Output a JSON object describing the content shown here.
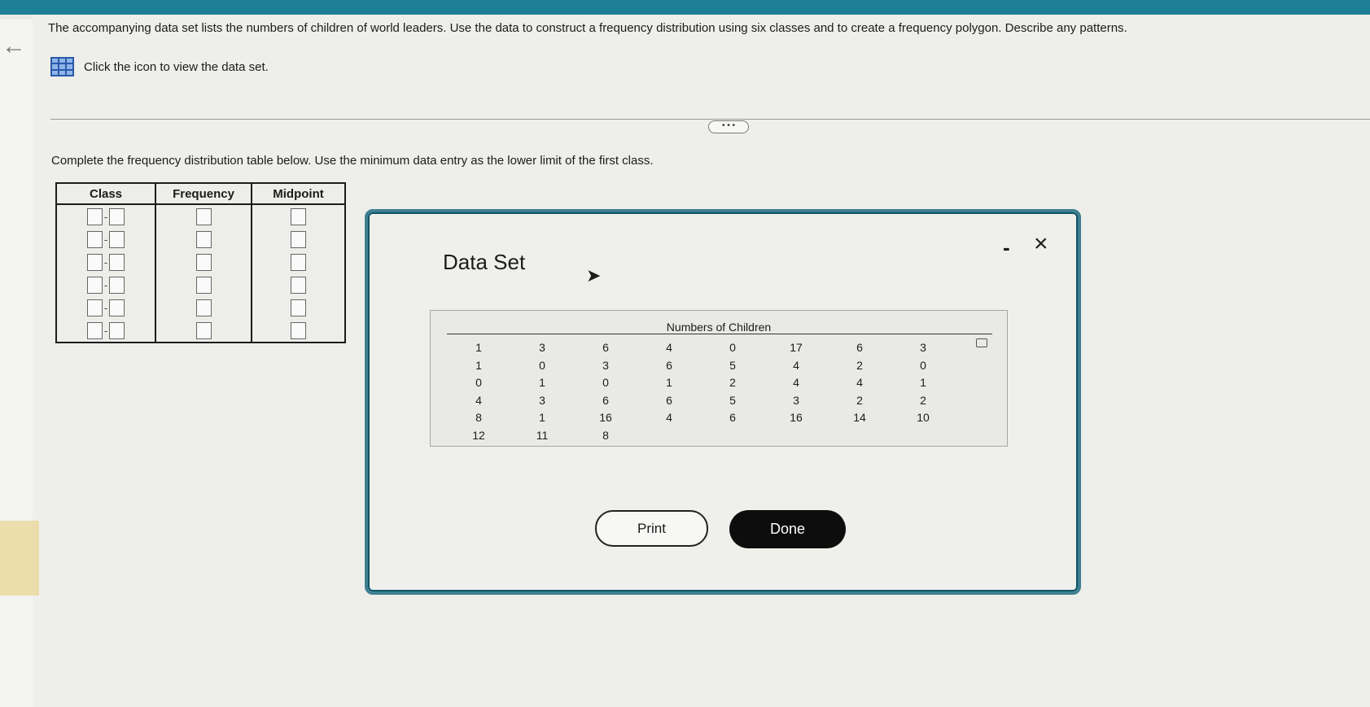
{
  "question": {
    "text": "The accompanying data set lists the numbers of children of world leaders. Use the data to construct a frequency distribution using six classes and to create a frequency polygon. Describe any patterns.",
    "data_link_label": "Click the icon to view the data set."
  },
  "more_button_label": "• • •",
  "instruction": "Complete the frequency distribution table below. Use the minimum data entry as the lower limit of the first class.",
  "table": {
    "headers": [
      "Class",
      "Frequency",
      "Midpoint"
    ],
    "row_count": 6
  },
  "modal": {
    "title": "Data Set",
    "minimize_label": "-",
    "close_label": "×",
    "data_header": "Numbers of Children",
    "columns": [
      [
        "1",
        "1",
        "0",
        "4",
        "8",
        "12"
      ],
      [
        "3",
        "0",
        "1",
        "3",
        "1",
        "11"
      ],
      [
        "6",
        "3",
        "0",
        "6",
        "16",
        "8"
      ],
      [
        "4",
        "6",
        "1",
        "6",
        "4"
      ],
      [
        "0",
        "5",
        "2",
        "5",
        "6"
      ],
      [
        "17",
        "4",
        "4",
        "3",
        "16"
      ],
      [
        "6",
        "2",
        "4",
        "2",
        "14"
      ],
      [
        "3",
        "0",
        "1",
        "2",
        "10"
      ]
    ],
    "print_label": "Print",
    "done_label": "Done"
  }
}
